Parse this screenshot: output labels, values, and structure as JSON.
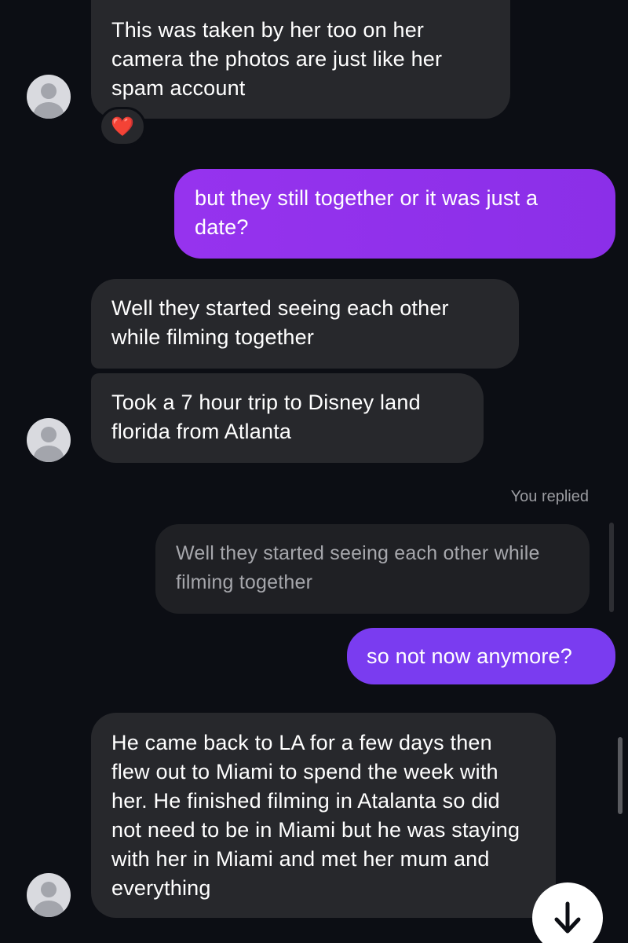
{
  "messages": {
    "m1": "This was taken by her too on her camera the photos are just like her spam account",
    "m1_reaction": "❤️",
    "m2": "but they still together or it was just a date?",
    "m3": "Well they started seeing each other while filming together",
    "m4": "Took a 7 hour trip to Disney land florida from Atlanta",
    "you_replied_label": "You replied",
    "quoted_reply": "Well they started seeing each other while filming together",
    "m5": "so not now anymore?",
    "m6": "He came back to LA for a few days then flew out to Miami to spend the week with her. He finished filming in Atalanta so did not need to be in Miami but he was staying with her in Miami and met her mum and everything"
  },
  "icons": {
    "avatar": "user-avatar-placeholder",
    "scroll_down": "arrow-down-icon"
  },
  "colors": {
    "background": "#0c0e14",
    "incoming_bubble": "#27282c",
    "outgoing_bubble": "#8b2fe8",
    "outgoing_bubble_2": "#7a3cf0"
  }
}
